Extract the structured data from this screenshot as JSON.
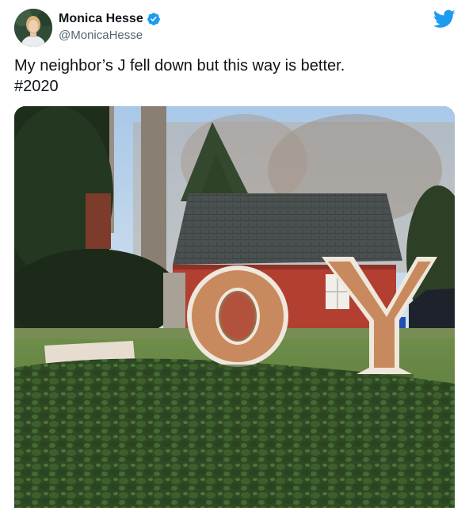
{
  "user": {
    "display_name": "Monica Hesse",
    "handle": "@MonicaHesse",
    "verified": true,
    "avatar_icon": "profile-photo"
  },
  "tweet": {
    "text_line1": "My neighbor’s J fell down but this way is better.",
    "hashtag": "#2020"
  },
  "photo": {
    "letters": [
      "O",
      "Y"
    ],
    "description_icon": "yard-sign-photo"
  },
  "colors": {
    "twitter_blue": "#1d9bf0",
    "text_primary": "#0f1419",
    "text_secondary": "#536471"
  }
}
